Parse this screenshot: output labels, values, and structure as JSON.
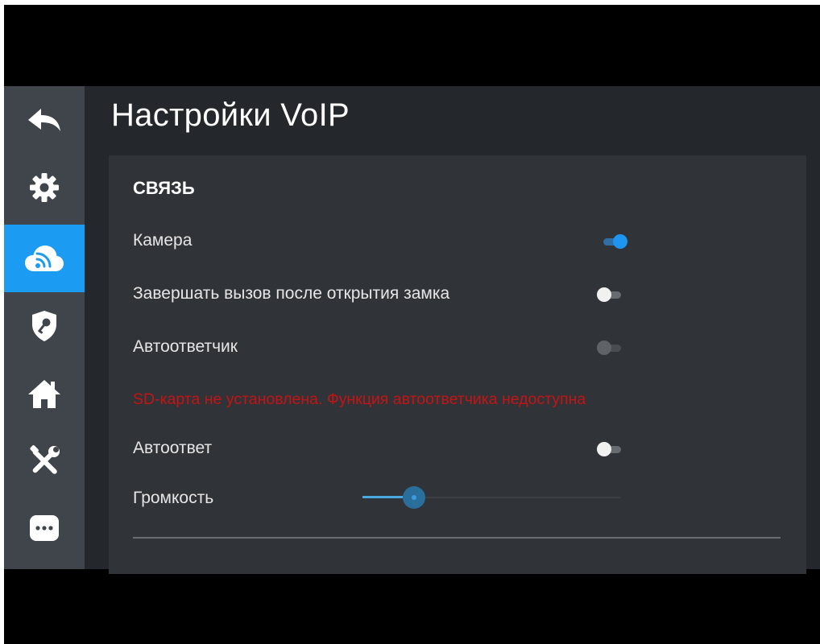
{
  "header": {
    "title": "Настройки VoIP"
  },
  "sidebar": {
    "items": [
      {
        "icon": "back-arrow-icon",
        "active": false
      },
      {
        "icon": "gear-icon",
        "active": false
      },
      {
        "icon": "cloud-wifi-icon",
        "active": true
      },
      {
        "icon": "shield-key-icon",
        "active": false
      },
      {
        "icon": "home-icon",
        "active": false
      },
      {
        "icon": "tools-icon",
        "active": false
      },
      {
        "icon": "chat-dots-icon",
        "active": false
      }
    ]
  },
  "section": {
    "title": "СВЯЗЬ",
    "camera": {
      "label": "Камера",
      "on": true
    },
    "end_call": {
      "label": "Завершать вызов после открытия замка",
      "on": false
    },
    "answering_machine": {
      "label": "Автоответчик",
      "on": false,
      "enabled": false
    },
    "warning": "SD-карта не установлена. Функция автоответчика недоступна",
    "auto_answer": {
      "label": "Автоответ",
      "on": false
    },
    "volume": {
      "label": "Громкость",
      "level": 0.2
    }
  },
  "colors": {
    "accent": "#1b9cf2",
    "warning": "#c41414",
    "background": "#24272b",
    "sidebar": "#40454b",
    "panel": "#303338"
  }
}
